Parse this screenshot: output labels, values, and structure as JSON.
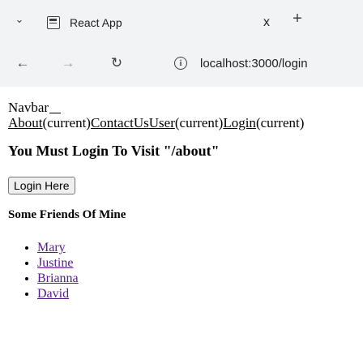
{
  "browser": {
    "tab": {
      "title": "React App",
      "close_label": "x"
    },
    "new_tab_label": "+",
    "url": "localhost:3000/login",
    "info_icon": "i"
  },
  "page": {
    "navbar": {
      "heading": "Navbar",
      "links": [
        {
          "text": "About",
          "suffix": "(current)"
        },
        {
          "text": "ContactUs",
          "suffix": ""
        },
        {
          "text": "User",
          "suffix": "(current)"
        },
        {
          "text": "Login",
          "suffix": "(current)"
        }
      ]
    },
    "main_heading": "You Must Login To Visit \"/about\"",
    "login_button": "Login Here",
    "friends_title": "Some Friends Of Mine",
    "friends": [
      "Mary",
      "Justine",
      "Brianna",
      "David"
    ],
    "colors": {
      "visited_link": "#551a8b"
    }
  }
}
